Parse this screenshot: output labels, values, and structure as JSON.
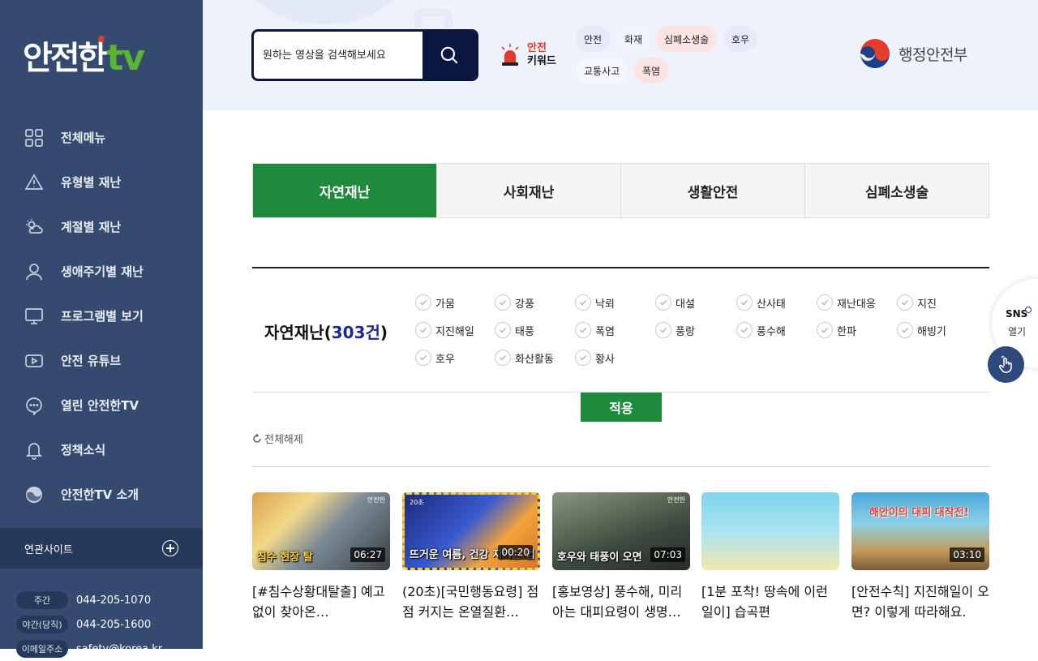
{
  "logo": {
    "main": "안전한",
    "tv": "tv"
  },
  "sidebar": {
    "items": [
      {
        "label": "전체메뉴",
        "icon": "grid-icon"
      },
      {
        "label": "유형별 재난",
        "icon": "warning-icon"
      },
      {
        "label": "계절별 재난",
        "icon": "weather-icon"
      },
      {
        "label": "생애주기별 재난",
        "icon": "person-icon"
      },
      {
        "label": "프로그램별 보기",
        "icon": "monitor-icon"
      },
      {
        "label": "안전 유튜브",
        "icon": "play-icon"
      },
      {
        "label": "열린 안전한TV",
        "icon": "chat-icon"
      },
      {
        "label": "정책소식",
        "icon": "bell-icon"
      },
      {
        "label": "안전한TV 소개",
        "icon": "emblem-icon"
      }
    ],
    "related_label": "연관사이트",
    "contacts": [
      {
        "tag": "주간",
        "value": "044-205-1070"
      },
      {
        "tag": "야간(당직)",
        "value": "044-205-1600"
      },
      {
        "tag": "이메일주소",
        "value": "safety@korea.kr"
      }
    ]
  },
  "header": {
    "search_placeholder": "원하는 영상을 검색해보세요",
    "keyword_label_1": "안전",
    "keyword_label_2": "키워드",
    "keywords": [
      "안전",
      "화재",
      "심폐소생술",
      "호우",
      "교통사고",
      "폭염"
    ],
    "ministry": "행정안전부"
  },
  "tabs": [
    "자연재난",
    "사회재난",
    "생활안전",
    "심폐소생술"
  ],
  "filter": {
    "title": "자연재난",
    "count": "303건",
    "options": [
      "가뭄",
      "강풍",
      "낙뢰",
      "대설",
      "산사태",
      "재난대응",
      "지진",
      "지진해일",
      "태풍",
      "폭염",
      "풍랑",
      "풍수해",
      "한파",
      "해빙기",
      "호우",
      "화산활동",
      "황사"
    ],
    "apply_label": "적용",
    "reset_label": "전체해제"
  },
  "videos": [
    {
      "title": "[#침수상황대탈출] 예고없이 찾아온…",
      "duration": "06:27",
      "caption": "침수 현장 탈",
      "badge": "안전한"
    },
    {
      "title": "(20초)[국민행동요령] 점점 커지는 온열질환…",
      "duration": "00:20",
      "caption": "뜨거운 여름, 건강 지키는 법",
      "badge": "20초"
    },
    {
      "title": "[홍보영상] 풍수해, 미리 아는 대피요령이 생명…",
      "duration": "07:03",
      "caption": "호우와 태풍이 오면",
      "badge": "안전한"
    },
    {
      "title": "[1분 포착! 땅속에 이런일이] 습곡편",
      "duration": "",
      "caption": "",
      "badge": ""
    },
    {
      "title": "[안전수칙] 지진해일이 오면? 이렇게 따라해요.",
      "duration": "03:10",
      "caption": "해안이의 대피 대작전!",
      "badge": ""
    }
  ],
  "sns": {
    "label": "SNS",
    "sub": "열기"
  },
  "colors": {
    "sidebar": "#344a6e",
    "accent_green": "#1e8a3b",
    "navy": "#0b1640",
    "count": "#1c2a8b"
  }
}
